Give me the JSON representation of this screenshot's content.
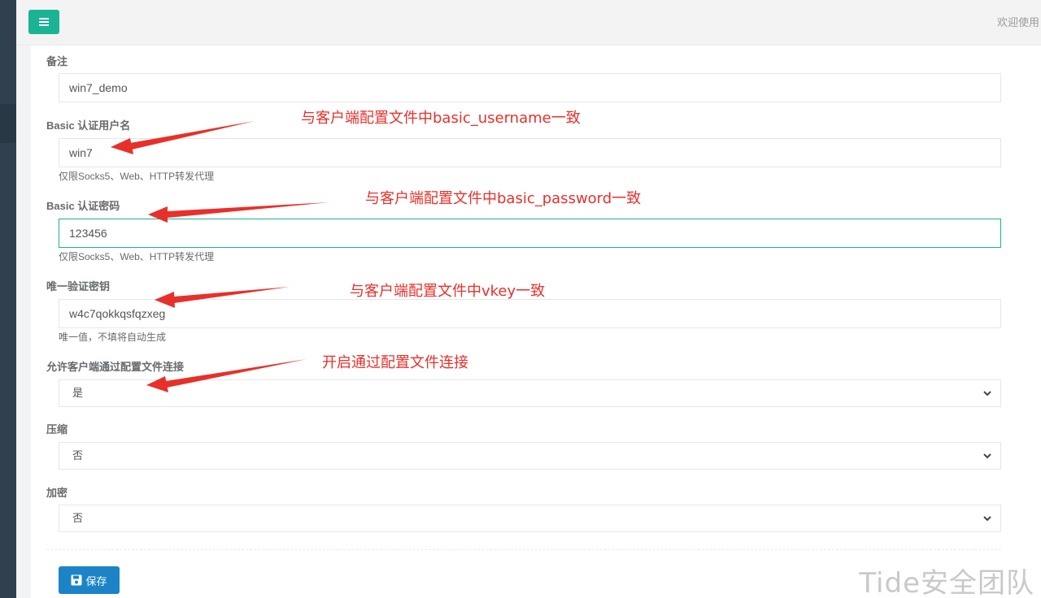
{
  "header": {
    "welcome_text": "欢迎使用"
  },
  "form": {
    "remark": {
      "label": "备注",
      "value": "win7_demo"
    },
    "basic_username": {
      "label": "Basic 认证用户名",
      "value": "win7",
      "help": "仅限Socks5、Web、HTTP转发代理"
    },
    "basic_password": {
      "label": "Basic 认证密码",
      "value": "123456",
      "help": "仅限Socks5、Web、HTTP转发代理"
    },
    "vkey": {
      "label": "唯一验证密钥",
      "value": "w4c7qokkqsfqzxeg",
      "help": "唯一值，不填将自动生成"
    },
    "config_conn": {
      "label": "允许客户端通过配置文件连接",
      "value": "是"
    },
    "compress": {
      "label": "压缩",
      "value": "否"
    },
    "crypt": {
      "label": "加密",
      "value": "否"
    },
    "save_label": "保存"
  },
  "annotations": {
    "username": "与客户端配置文件中basic_username一致",
    "password": "与客户端配置文件中basic_password一致",
    "vkey": "与客户端配置文件中vkey一致",
    "config": "开启通过配置文件连接"
  },
  "watermark": "Tide安全团队",
  "colors": {
    "accent": "#1ab394",
    "primary_button": "#1c84c6",
    "annotation": "#e8302a",
    "sidebar": "#2f4050"
  },
  "icons": {
    "menu": "hamburger-icon",
    "save": "floppy-disk-icon",
    "select": "chevron-down-icon"
  }
}
